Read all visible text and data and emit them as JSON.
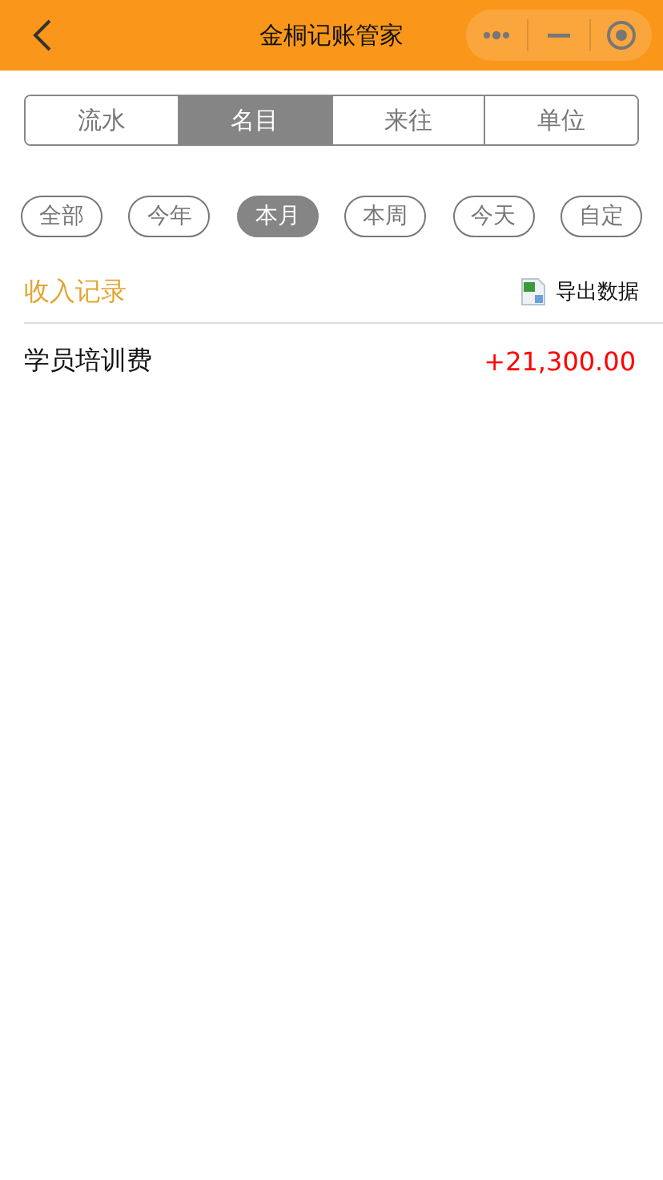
{
  "nav_bar": {
    "title": "金桐记账管家"
  },
  "tabs": [
    {
      "label": "流水",
      "selected": false
    },
    {
      "label": "名目",
      "selected": true
    },
    {
      "label": "来往",
      "selected": false
    },
    {
      "label": "单位",
      "selected": false
    }
  ],
  "periods": [
    {
      "label": "全部",
      "selected": false
    },
    {
      "label": "今年",
      "selected": false
    },
    {
      "label": "本月",
      "selected": true
    },
    {
      "label": "本周",
      "selected": false
    },
    {
      "label": "今天",
      "selected": false
    },
    {
      "label": "自定",
      "selected": false
    }
  ],
  "section": {
    "title": "收入记录",
    "export_label": "导出数据"
  },
  "records": [
    {
      "name": "学员培训费",
      "amount": "+21,300.00"
    }
  ]
}
